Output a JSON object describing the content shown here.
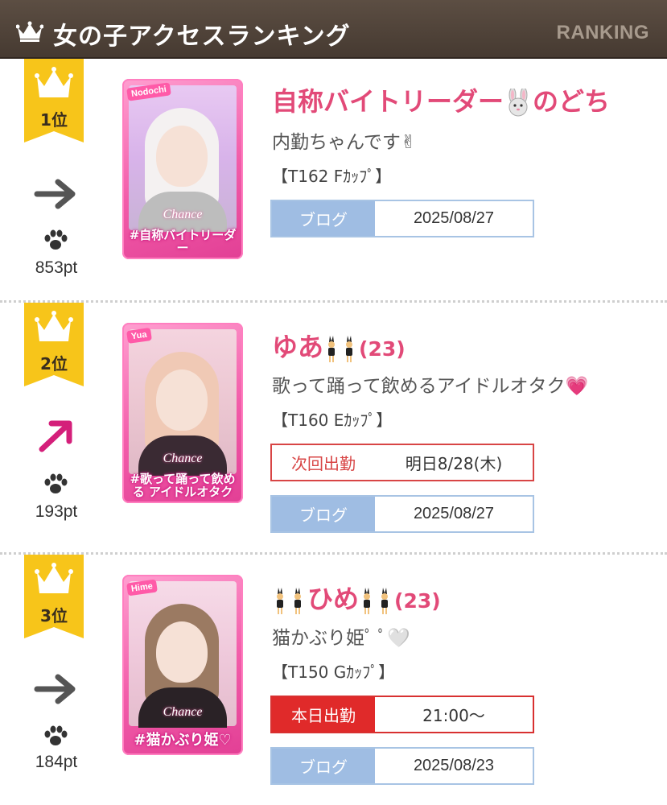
{
  "header": {
    "title": "女の子アクセスランキング",
    "ranking_label": "RANKING",
    "crown_color": "#ffffff"
  },
  "colors": {
    "header_bg": "#4f4238",
    "badge_gold": "#f7c51a",
    "name_pink": "#e24a78",
    "blog_blue": "#9fbde3",
    "schedule_red": "#d84545"
  },
  "entries": [
    {
      "rank_label": "1位",
      "trend": "flat-arrow-icon",
      "points": "853pt",
      "name": "自称バイトリーダー🐰のどち",
      "name_text": "自称バイトリーダー",
      "name_suffix": "のどち",
      "name_icon": "rabbit-face-icon",
      "catchphrase": "内勤ちゃんです✌",
      "size": "【T162 Fｶｯﾌﾟ】",
      "photo": {
        "name_tag": "Nodochi",
        "brand": "Chance",
        "tagline": "#自称バイトリーダー"
      },
      "blog_label": "ブログ",
      "blog_date": "2025/08/27"
    },
    {
      "rank_label": "2位",
      "trend": "up-right-arrow-icon",
      "points": "193pt",
      "name": "ゆあ",
      "name_icon": "bunny-dancers-icon",
      "age": "(23)",
      "catchphrase": "歌って踊って飲めるアイドルオタク💗",
      "size": "【T160 Eｶｯﾌﾟ】",
      "photo": {
        "name_tag": "Yua",
        "brand": "Chance",
        "tagline": "#歌って踊って飲める アイドルオタク"
      },
      "schedule_label": "次回出勤",
      "schedule_value": "明日8/28(木)",
      "blog_label": "ブログ",
      "blog_date": "2025/08/27"
    },
    {
      "rank_label": "3位",
      "trend": "flat-arrow-icon",
      "points": "184pt",
      "name": "ひめ",
      "name_icon": "bunny-dancers-icon",
      "age": "(23)",
      "catchphrase": "猫かぶり姫ﾟ ﾟ🤍",
      "size": "【T150 Gｶｯﾌﾟ】",
      "photo": {
        "name_tag": "Hime",
        "brand": "Chance",
        "tagline": "#猫かぶり姫♡"
      },
      "schedule_label": "本日出勤",
      "schedule_value": "21:00～",
      "blog_label": "ブログ",
      "blog_date": "2025/08/23"
    }
  ]
}
